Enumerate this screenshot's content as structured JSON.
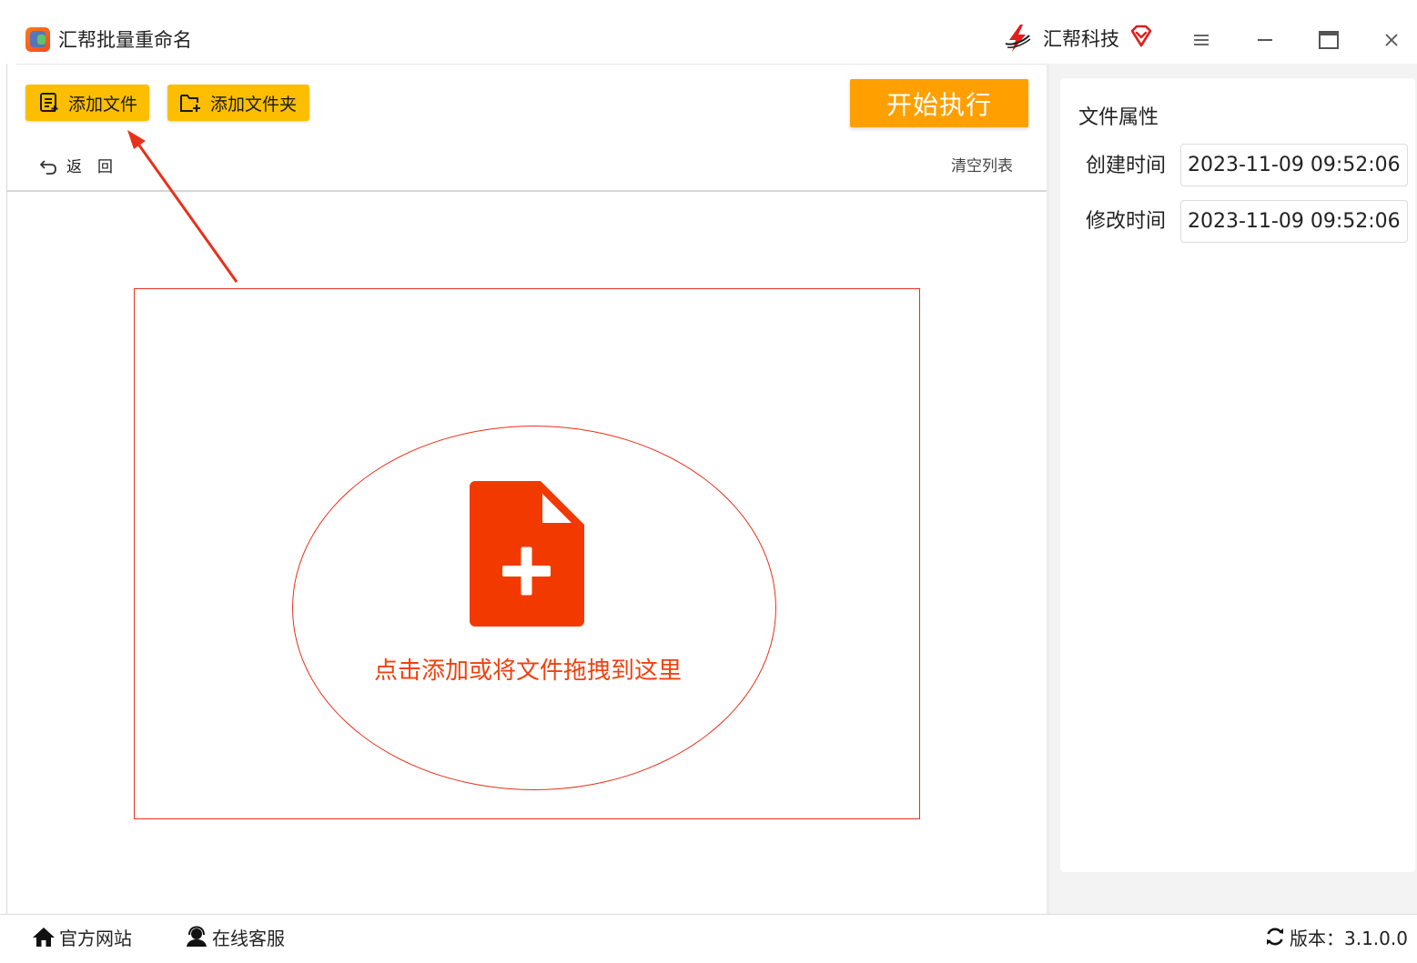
{
  "app": {
    "title": "汇帮批量重命名",
    "brand": "汇帮科技"
  },
  "toolbar": {
    "add_file": "添加文件",
    "add_folder": "添加文件夹",
    "start": "开始执行",
    "back": "返回",
    "clear_list": "清空列表"
  },
  "dropzone": {
    "hint": "点击添加或将文件拖拽到这里"
  },
  "properties": {
    "title": "文件属性",
    "created_label": "创建时间",
    "created_value": "2023-11-09 09:52:06",
    "modified_label": "修改时间",
    "modified_value": "2023-11-09 09:52:06"
  },
  "footer": {
    "website": "官方网站",
    "support": "在线客服",
    "version": "版本：3.1.0.0"
  },
  "icons": {
    "app_logo": "app-logo-icon",
    "brand_logo": "brand-logo-icon",
    "vip": "diamond-vip-icon",
    "menu": "hamburger-menu-icon",
    "minimize": "minimize-icon",
    "maximize": "maximize-icon",
    "close": "close-icon",
    "add_file": "file-list-add-icon",
    "add_folder": "folder-add-icon",
    "back": "undo-arrow-icon",
    "file_add": "file-plus-icon",
    "home": "home-icon",
    "support": "headset-user-icon",
    "refresh": "refresh-icon"
  },
  "colors": {
    "accent_yellow": "#fdbe00",
    "start_orange": "#ffa000",
    "drop_red": "#e8311a",
    "drop_text": "#f0410d",
    "file_icon": "#f23a00"
  }
}
